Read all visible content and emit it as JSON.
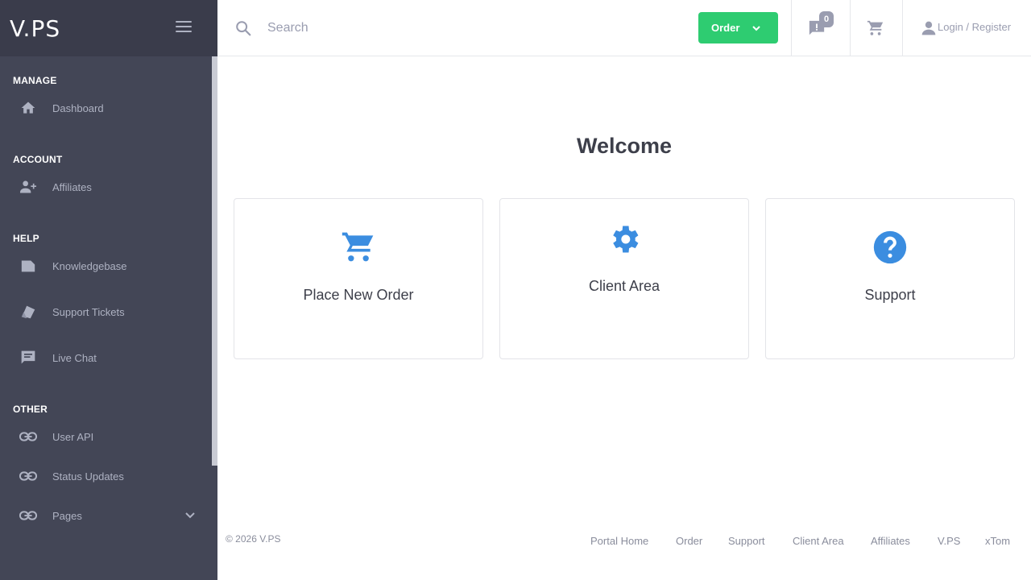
{
  "brand": {
    "logo": "V.PS"
  },
  "sidebar": {
    "sections": [
      {
        "title": "MANAGE",
        "items": [
          {
            "label": "Dashboard",
            "icon": "home-icon"
          }
        ]
      },
      {
        "title": "ACCOUNT",
        "items": [
          {
            "label": "Affiliates",
            "icon": "user-add-icon"
          }
        ]
      },
      {
        "title": "HELP",
        "items": [
          {
            "label": "Knowledgebase",
            "icon": "folder-icon"
          },
          {
            "label": "Support Tickets",
            "icon": "ticket-icon"
          },
          {
            "label": "Live Chat",
            "icon": "chat-icon"
          }
        ]
      },
      {
        "title": "OTHER",
        "items": [
          {
            "label": "User API",
            "icon": "link-icon"
          },
          {
            "label": "Status Updates",
            "icon": "link-icon"
          },
          {
            "label": "Pages",
            "icon": "link-icon",
            "expandable": true
          }
        ]
      }
    ]
  },
  "topbar": {
    "search_placeholder": "Search",
    "order_label": "Order",
    "notification_count": "0",
    "login_label": "Login / Register"
  },
  "main": {
    "welcome": "Welcome",
    "cards": [
      {
        "label": "Place New Order",
        "icon": "cart-icon"
      },
      {
        "label": "Client Area",
        "icon": "gear-icon"
      },
      {
        "label": "Support",
        "icon": "question-icon"
      }
    ]
  },
  "footer": {
    "copyright": "© 2026 V.PS",
    "links": [
      "Portal Home",
      "Order",
      "Support",
      "Client Area",
      "Affiliates",
      "V.PS",
      "xTom"
    ]
  },
  "colors": {
    "sidebar_bg": "#434656",
    "accent_green": "#2ecc71",
    "accent_blue": "#3b8de0"
  }
}
